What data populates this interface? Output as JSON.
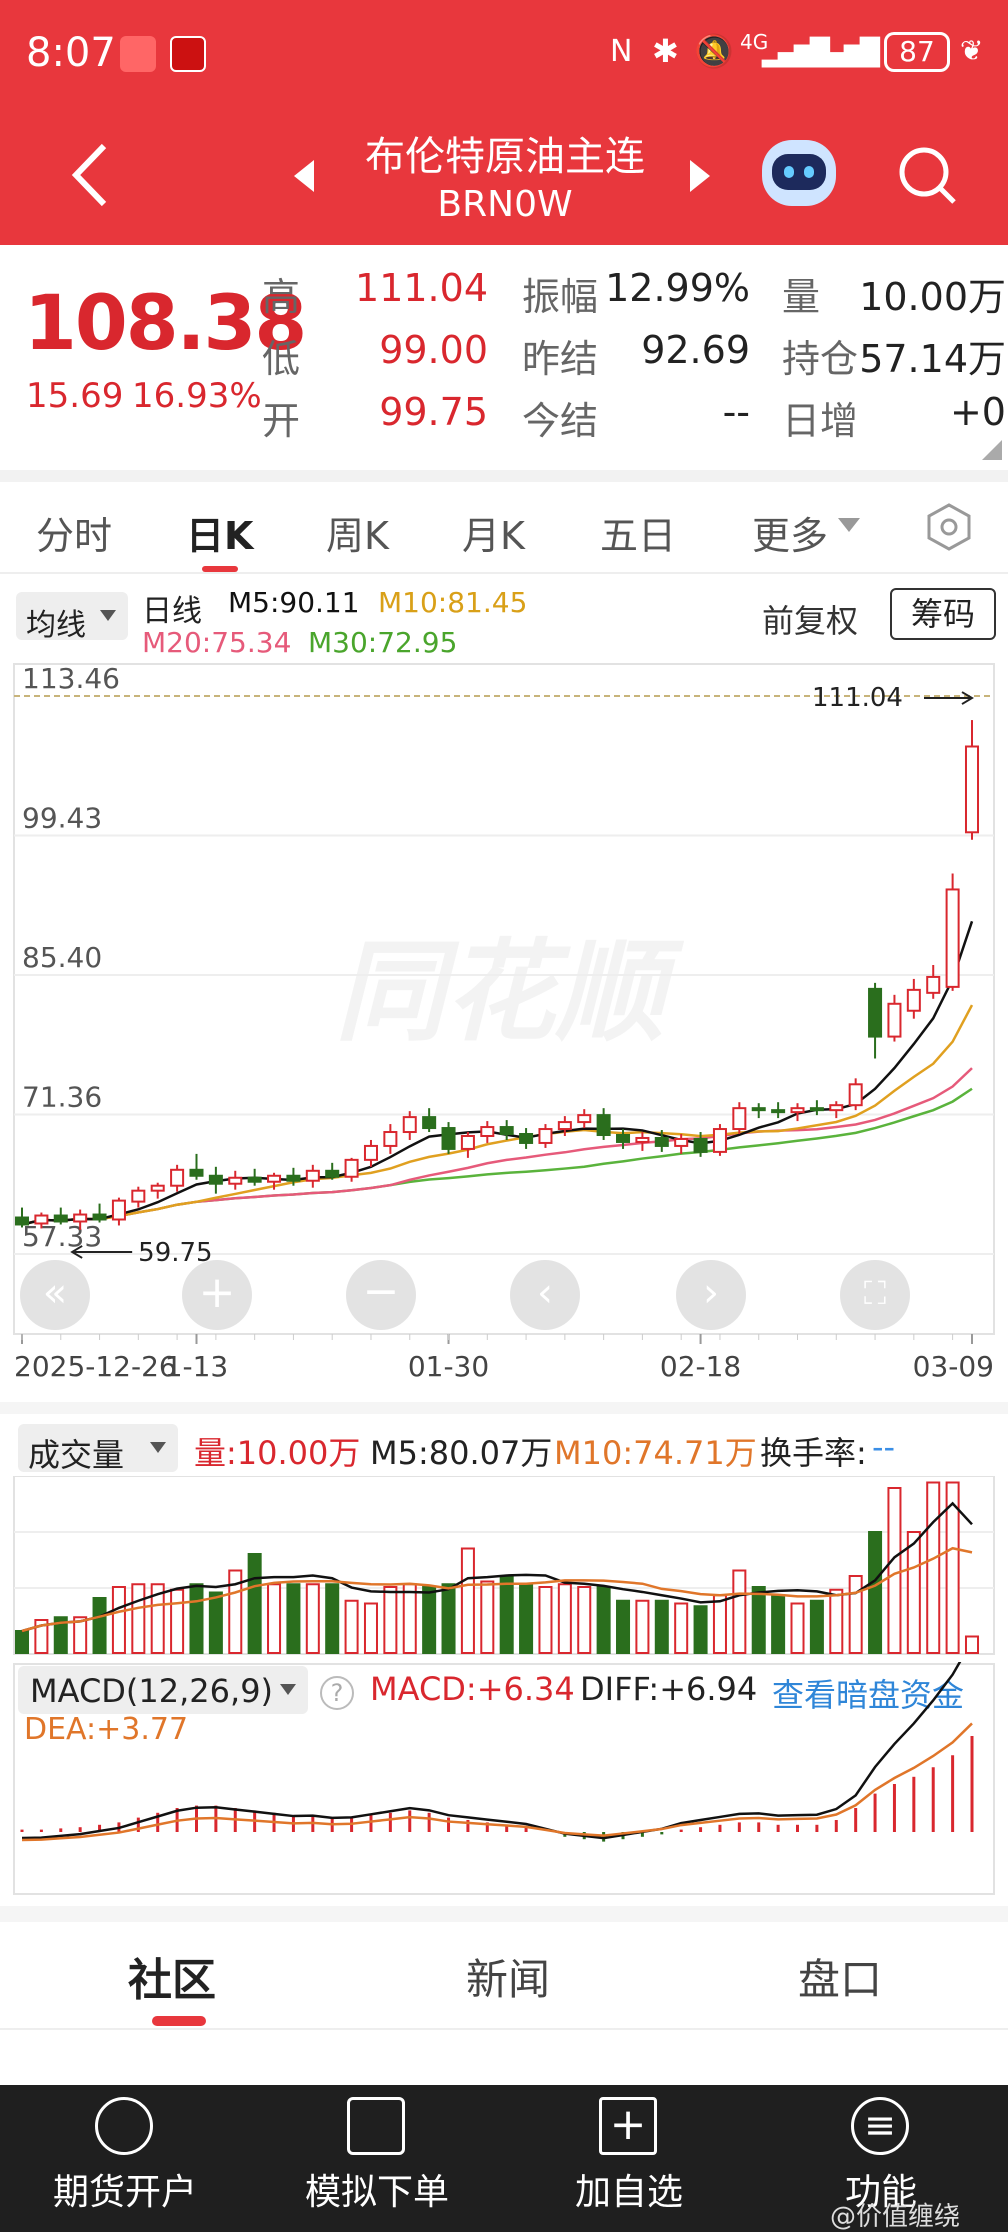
{
  "status_bar": {
    "time": "8:07",
    "network": "4G",
    "battery": "87"
  },
  "header": {
    "title": "布伦特原油主连",
    "code": "BRN0W"
  },
  "quote": {
    "price": "108.38",
    "change": "15.69",
    "change_pct": "16.93%",
    "high_label": "高",
    "high": "111.04",
    "low_label": "低",
    "low": "99.00",
    "open_label": "开",
    "open": "99.75",
    "amp_label": "振幅",
    "amp": "12.99%",
    "prev_settle_label": "昨结",
    "prev_settle": "92.69",
    "settle_label": "今结",
    "settle": "--",
    "vol_label": "量",
    "vol": "10.00万",
    "oi_label": "持仓",
    "oi": "57.14万",
    "daily_inc_label": "日增",
    "daily_inc": "+0"
  },
  "tabs": [
    "分时",
    "日K",
    "周K",
    "月K",
    "五日",
    "更多"
  ],
  "active_tab": "日K",
  "kline": {
    "ma_select": "均线",
    "line_label": "日线",
    "m5": "M5:90.11",
    "m10": "M10:81.45",
    "m20": "M20:75.34",
    "m30": "M30:72.95",
    "adjust": "前复权",
    "chips": "筹码",
    "y_ticks": [
      "113.46",
      "99.43",
      "85.40",
      "71.36",
      "57.33"
    ],
    "high_mark": "111.04",
    "low_mark": "59.75",
    "x_labels": [
      "2025-12-26",
      "1-13",
      "01-30",
      "02-18",
      "03-09"
    ],
    "watermark": "同花顺"
  },
  "volume": {
    "select": "成交量",
    "vol": "量:10.00万",
    "m5": "M5:80.07万",
    "m10": "M10:74.71万",
    "turnover_label": "换手率:",
    "turnover": "--"
  },
  "macd": {
    "select": "MACD(12,26,9)",
    "macd": "MACD:+6.34",
    "diff": "DIFF:+6.94",
    "dea": "DEA:+3.77",
    "link": "查看暗盘资金"
  },
  "section_tabs": [
    "社区",
    "新闻",
    "盘口"
  ],
  "bottom_nav": [
    "期货开户",
    "模拟下单",
    "加自选",
    "功能"
  ],
  "watermark_text": "@价值缠绕",
  "colors": {
    "up": "#d9272e",
    "down": "#2a6e1d",
    "ma5": "#111111",
    "ma10": "#e0a020",
    "ma20": "#e65a7a",
    "ma30": "#5ab33c",
    "header": "#e8373d"
  },
  "chart_data": {
    "type": "candlestick",
    "x_labels": [
      "2025-12-26",
      "1-13",
      "01-30",
      "02-18",
      "03-09"
    ],
    "y_range": [
      57.33,
      113.46
    ],
    "ohlc": [
      [
        61.0,
        62.0,
        60.0,
        60.3
      ],
      [
        60.4,
        61.5,
        59.9,
        61.2
      ],
      [
        61.2,
        62.0,
        60.3,
        60.6
      ],
      [
        60.6,
        61.8,
        59.75,
        61.3
      ],
      [
        61.3,
        62.4,
        60.5,
        60.8
      ],
      [
        60.8,
        63.0,
        60.2,
        62.7
      ],
      [
        62.6,
        64.1,
        62.0,
        63.7
      ],
      [
        63.7,
        64.5,
        62.9,
        64.2
      ],
      [
        64.2,
        66.3,
        63.6,
        65.8
      ],
      [
        65.8,
        67.4,
        64.8,
        65.2
      ],
      [
        65.2,
        66.1,
        63.4,
        64.4
      ],
      [
        64.4,
        65.7,
        63.8,
        65.0
      ],
      [
        65.0,
        65.9,
        64.2,
        64.6
      ],
      [
        64.6,
        65.5,
        63.8,
        65.2
      ],
      [
        65.2,
        66.0,
        64.2,
        64.7
      ],
      [
        64.7,
        66.3,
        64.0,
        65.7
      ],
      [
        65.7,
        66.5,
        64.8,
        65.1
      ],
      [
        65.1,
        67.0,
        64.6,
        66.8
      ],
      [
        66.8,
        68.8,
        66.1,
        68.2
      ],
      [
        68.2,
        70.4,
        67.4,
        69.6
      ],
      [
        69.6,
        71.7,
        68.8,
        71.1
      ],
      [
        71.1,
        72.0,
        69.6,
        70.0
      ],
      [
        70.0,
        70.6,
        67.4,
        67.9
      ],
      [
        67.9,
        69.6,
        67.0,
        69.2
      ],
      [
        69.2,
        70.7,
        68.5,
        70.1
      ],
      [
        70.1,
        70.8,
        68.8,
        69.4
      ],
      [
        69.4,
        70.0,
        67.9,
        68.5
      ],
      [
        68.5,
        70.4,
        68.0,
        69.9
      ],
      [
        69.9,
        71.2,
        69.2,
        70.6
      ],
      [
        70.6,
        71.9,
        70.0,
        71.3
      ],
      [
        71.3,
        72.0,
        68.8,
        69.3
      ],
      [
        69.3,
        69.9,
        67.9,
        68.6
      ],
      [
        68.6,
        69.6,
        67.7,
        69.0
      ],
      [
        69.0,
        69.8,
        67.6,
        68.2
      ],
      [
        68.2,
        69.4,
        67.4,
        68.9
      ],
      [
        68.9,
        69.6,
        67.1,
        67.6
      ],
      [
        67.6,
        70.4,
        67.2,
        69.9
      ],
      [
        69.9,
        72.6,
        69.4,
        72.0
      ],
      [
        72.0,
        72.5,
        71.0,
        71.8
      ],
      [
        71.8,
        72.6,
        71.0,
        71.6
      ],
      [
        71.6,
        72.5,
        70.7,
        72.0
      ],
      [
        72.0,
        72.8,
        71.3,
        71.8
      ],
      [
        71.8,
        72.7,
        71.0,
        72.3
      ],
      [
        72.3,
        75.0,
        71.8,
        74.4
      ],
      [
        84.0,
        84.6,
        77.0,
        79.2
      ],
      [
        79.2,
        83.4,
        78.7,
        82.5
      ],
      [
        81.8,
        85.0,
        81.0,
        83.9
      ],
      [
        83.6,
        86.4,
        83.0,
        85.2
      ],
      [
        84.2,
        95.6,
        83.8,
        94.0
      ],
      [
        99.75,
        111.04,
        99.0,
        108.38
      ]
    ],
    "volume": [
      8,
      12,
      13,
      13,
      20,
      24,
      25,
      25,
      23,
      25,
      22,
      30,
      36,
      25,
      25,
      25,
      25,
      19,
      18,
      24,
      25,
      24,
      25,
      38,
      26,
      28,
      25,
      24,
      25,
      24,
      24,
      19,
      19,
      19,
      18,
      17,
      21,
      30,
      24,
      21,
      18,
      19,
      23,
      28,
      44,
      60,
      44,
      62,
      62,
      6
    ],
    "macd_hist": [
      0.1,
      0.1,
      0.15,
      0.2,
      0.3,
      0.4,
      0.6,
      0.8,
      1.0,
      1.1,
      1.1,
      1.0,
      0.9,
      0.8,
      0.7,
      0.7,
      0.6,
      0.6,
      0.7,
      0.8,
      0.9,
      0.8,
      0.6,
      0.5,
      0.4,
      0.3,
      0.2,
      0.0,
      -0.2,
      -0.3,
      -0.4,
      -0.3,
      -0.2,
      -0.1,
      0.1,
      0.2,
      0.3,
      0.4,
      0.4,
      0.3,
      0.3,
      0.3,
      0.5,
      1.0,
      1.6,
      2.0,
      2.3,
      2.7,
      3.2,
      4.0
    ]
  }
}
